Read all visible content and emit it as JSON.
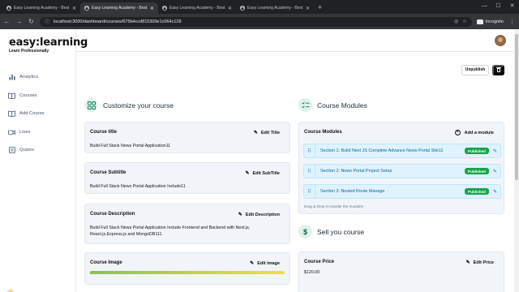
{
  "browser": {
    "tabs": [
      {
        "title": "Easy Learning Academy - Best",
        "active": false
      },
      {
        "title": "Easy Learning Academy - Best",
        "active": true
      },
      {
        "title": "Easy Learning Academy - Best",
        "active": false
      },
      {
        "title": "Easy Learning Academy - Best",
        "active": false
      }
    ],
    "url": "localhost:3000/dashboard/courses/675b4ccd815300e1c064c128",
    "incognito_label": "Incognito"
  },
  "app": {
    "logo": "easy:learning",
    "tagline": "Learn Professionally"
  },
  "sidebar": {
    "items": [
      {
        "label": "Analytics",
        "icon": "bar-chart-icon"
      },
      {
        "label": "Courses",
        "icon": "book-icon"
      },
      {
        "label": "Add Course",
        "icon": "book-plus-icon"
      },
      {
        "label": "Lives",
        "icon": "video-icon"
      },
      {
        "label": "Quizes",
        "icon": "list-icon"
      }
    ]
  },
  "actions": {
    "unpublish_label": "Unpublish"
  },
  "customize": {
    "heading": "Customize your course",
    "title_card": {
      "label": "Course title",
      "action": "Edit Title",
      "value": "Build Full Stack News Portal Application11"
    },
    "subtitle_card": {
      "label": "Course Subtitle",
      "action": "Edit SubTitle",
      "value": "Build Full Stack News Portal Application Include11"
    },
    "description_card": {
      "label": "Course Description",
      "action": "Edit Description",
      "value": "Build Full Stack News Portal Application Include Frontend and Backend with Next.js, React.js,Express.js and MongoDB111"
    },
    "image_card": {
      "label": "Course Image",
      "action": "Edit image"
    }
  },
  "modules": {
    "heading": "Course Modules",
    "card_label": "Course Modules",
    "add_label": "Add a module",
    "chapters": [
      {
        "title": "Section 1: Build Next JS Complete Advance News Portal Site11",
        "status": "Published"
      },
      {
        "title": "Section 2: News Portal Project Setup",
        "status": "Published"
      },
      {
        "title": "Section 3: Nested Route Manage",
        "status": "Published"
      }
    ],
    "hint": "Drag & Drop to reorder the modules"
  },
  "sell": {
    "heading": "Sell you course",
    "price_label": "Course Price",
    "price_action": "Edit Price",
    "price_value": "$120.00"
  },
  "colors": {
    "accent_green": "#16a34a",
    "chapter_blue": "#0369a1",
    "card_bg": "#f1f5f9"
  }
}
